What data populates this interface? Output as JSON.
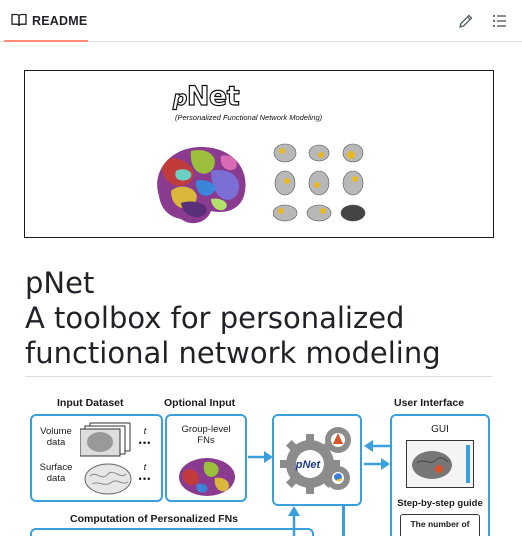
{
  "tab": {
    "label": "README",
    "icon": "book-icon"
  },
  "actions": {
    "edit_icon": "pencil-icon",
    "toc_icon": "list-icon"
  },
  "banner": {
    "logo": "Net",
    "logo_prefix": "p",
    "subtitle": "(Personalized Functional Network Modeling)"
  },
  "heading": {
    "line1": "pNet",
    "line2": "A toolbox for personalized",
    "line3": "functional network modeling"
  },
  "diagram": {
    "input_dataset": "Input Dataset",
    "optional_input": "Optional Input",
    "user_interface": "User Interface",
    "volume_data_1": "Volume",
    "volume_data_2": "data",
    "surface_data_1": "Surface",
    "surface_data_2": "data",
    "t_label": "t",
    "group_level_1": "Group-level",
    "group_level_2": "FNs",
    "gui": "GUI",
    "step_guide": "Step-by-step guide",
    "number_of": "The number of",
    "computation": "Computation of Personalized FNs",
    "center_logo": "pNet"
  },
  "colors": {
    "accent": "#fd8c73",
    "diagram_blue": "#3aa0dc"
  }
}
